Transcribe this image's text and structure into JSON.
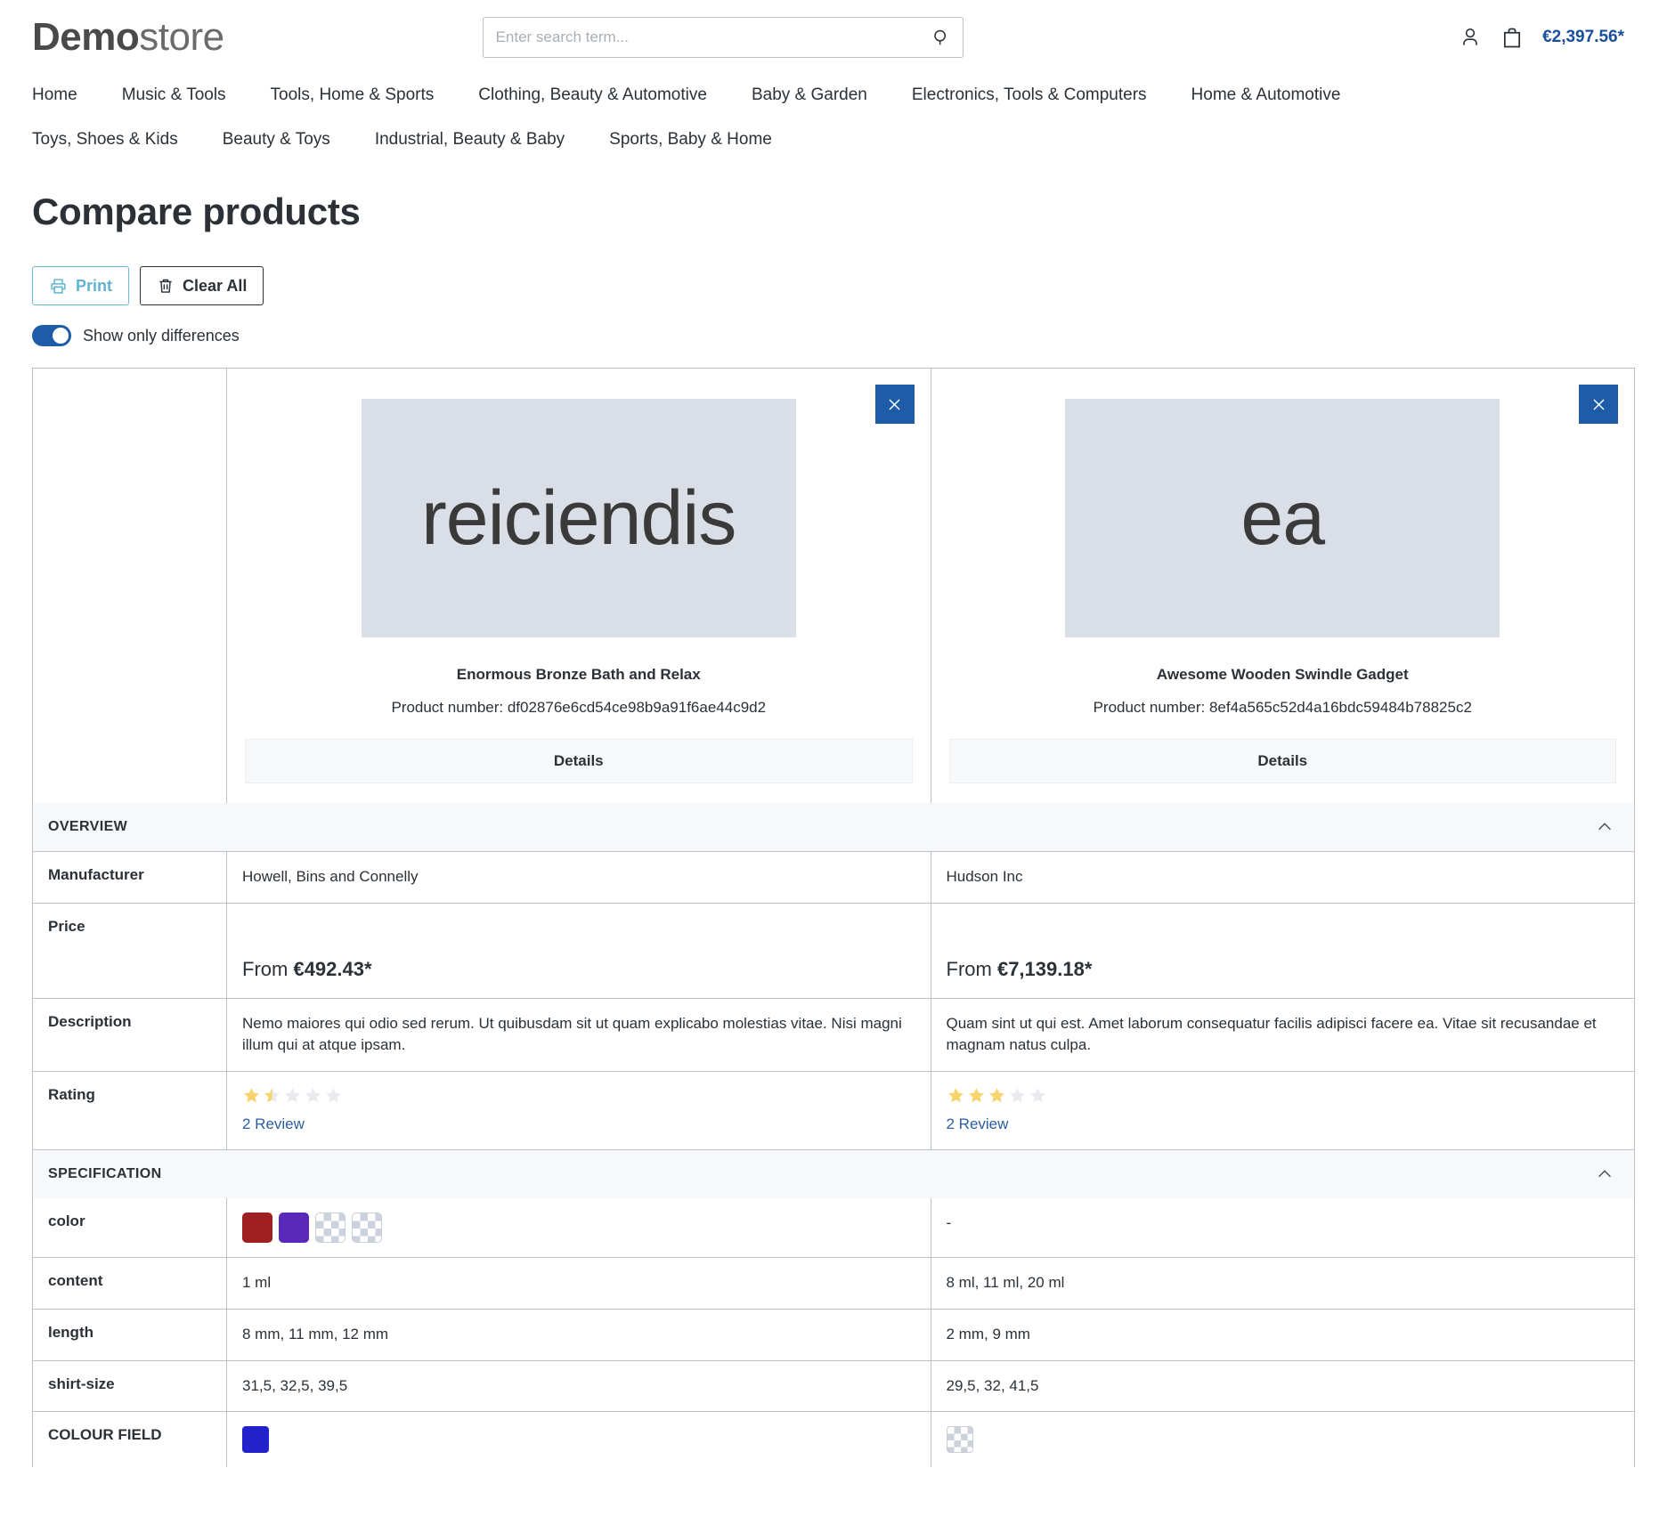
{
  "header": {
    "logo_bold": "Demo",
    "logo_light": "store",
    "search": {
      "placeholder": "Enter search term...",
      "value": "",
      "icon": "search-icon"
    },
    "account_icon": "user-icon",
    "cart_icon": "shopping-bag-icon",
    "cart_total": "€2,397.56*"
  },
  "nav": {
    "row1": [
      "Home",
      "Music & Tools",
      "Tools, Home & Sports",
      "Clothing, Beauty & Automotive",
      "Baby & Garden",
      "Electronics, Tools & Computers",
      "Home & Automotive"
    ],
    "row2": [
      "Toys, Shoes & Kids",
      "Beauty & Toys",
      "Industrial, Beauty & Baby",
      "Sports, Baby & Home"
    ]
  },
  "page": {
    "title": "Compare products",
    "print_label": "Print",
    "print_icon": "printer-icon",
    "clear_label": "Clear All",
    "clear_icon": "trash-icon",
    "toggle_label": "Show only differences",
    "toggle_on": true
  },
  "products": [
    {
      "image_text": "reiciendis",
      "name": "Enormous Bronze Bath and Relax",
      "number": "Product number: df02876e6cd54ce98b9a91f6ae44c9d2",
      "details_label": "Details",
      "close_icon": "close-icon"
    },
    {
      "image_text": "ea",
      "name": "Awesome Wooden Swindle Gadget",
      "number": "Product number: 8ef4a565c52d4a16bdc59484b78825c2",
      "details_label": "Details",
      "close_icon": "close-icon"
    }
  ],
  "sections": {
    "overview": {
      "title": "OVERVIEW",
      "chevron": "chevron-up-icon",
      "manufacturer": {
        "label": "Manufacturer",
        "values": [
          "Howell, Bins and Connelly",
          "Hudson Inc"
        ]
      },
      "price": {
        "label": "Price",
        "values": [
          {
            "prefix": "From ",
            "amount": "€492.43*"
          },
          {
            "prefix": "From ",
            "amount": "€7,139.18*"
          }
        ]
      },
      "description": {
        "label": "Description",
        "values": [
          "Nemo maiores qui odio sed rerum. Ut quibusdam sit ut quam explicabo molestias vitae. Nisi magni illum qui at atque ipsam.",
          "Quam sint ut qui est. Amet laborum consequatur facilis adipisci facere ea. Vitae sit recusandae et magnam natus culpa."
        ]
      },
      "rating": {
        "label": "Rating",
        "values": [
          {
            "stars": 1.5,
            "max": 5,
            "review_text": "2 Review"
          },
          {
            "stars": 3,
            "max": 5,
            "review_text": "2 Review"
          }
        ]
      }
    },
    "specification": {
      "title": "SPECIFICATION",
      "chevron": "chevron-up-icon",
      "rows": [
        {
          "label": "color",
          "type": "swatches",
          "values": [
            [
              "#9e2020",
              "#5b29ba",
              "transparent",
              "transparent"
            ],
            "-"
          ]
        },
        {
          "label": "content",
          "type": "text",
          "values": [
            "1 ml",
            "8 ml, 11 ml, 20 ml"
          ]
        },
        {
          "label": "length",
          "type": "text",
          "values": [
            "8 mm, 11 mm, 12 mm",
            "2 mm, 9 mm"
          ]
        },
        {
          "label": "shirt-size",
          "type": "text",
          "values": [
            "31,5, 32,5, 39,5",
            "29,5, 32, 41,5"
          ]
        },
        {
          "label": "COLOUR FIELD",
          "type": "swatches",
          "values": [
            [
              "#2222cc"
            ],
            [
              "transparent"
            ]
          ]
        }
      ]
    }
  },
  "colors": {
    "accent_blue": "#1f5ca8",
    "link_blue": "#2b5ea0",
    "print_cyan": "#5fb3d1",
    "star_gold": "#f8d26a",
    "star_grey": "#e8eaed",
    "image_bg": "#dadee6",
    "border": "#bcc1c7"
  }
}
